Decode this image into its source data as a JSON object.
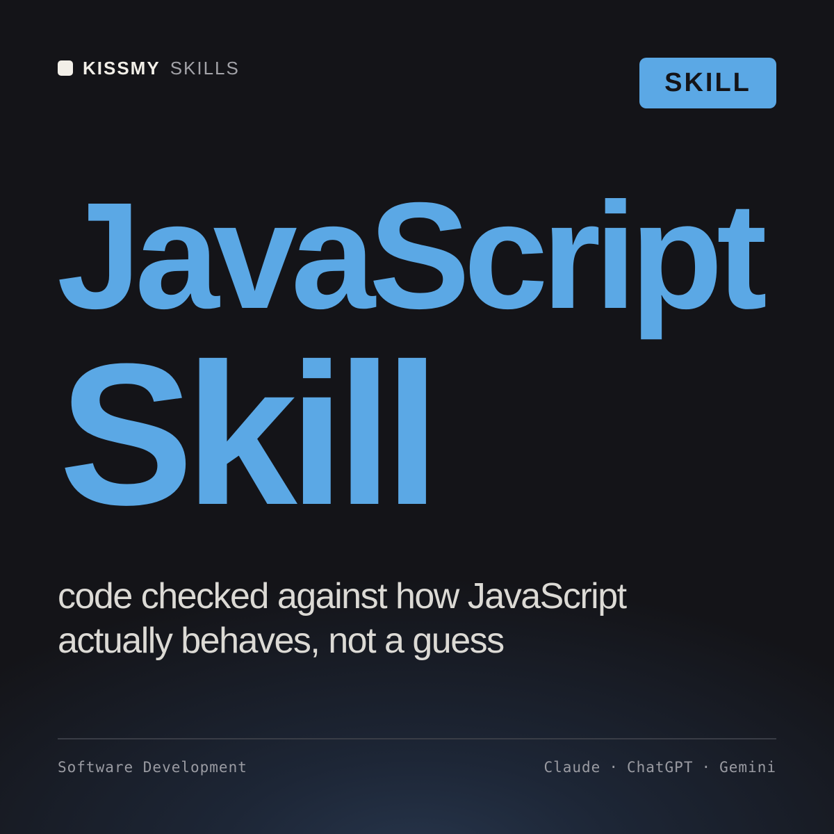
{
  "brand": {
    "name": "KISSMY",
    "sub": "SKILLS",
    "dot_icon": "square-dot-icon"
  },
  "badge": {
    "label": "SKILL"
  },
  "title": {
    "line1": "JavaScript",
    "line2": "Skill"
  },
  "subtitle": {
    "line1": "code checked against how JavaScript",
    "line2": "actually behaves, not a guess"
  },
  "footer": {
    "category": "Software Development",
    "platforms": [
      "Claude",
      "ChatGPT",
      "Gemini"
    ],
    "separator": "·"
  },
  "colors": {
    "background": "#141418",
    "accent": "#5ba8e5",
    "text_light": "#dcdad5",
    "text_muted": "#9a9ba2"
  }
}
